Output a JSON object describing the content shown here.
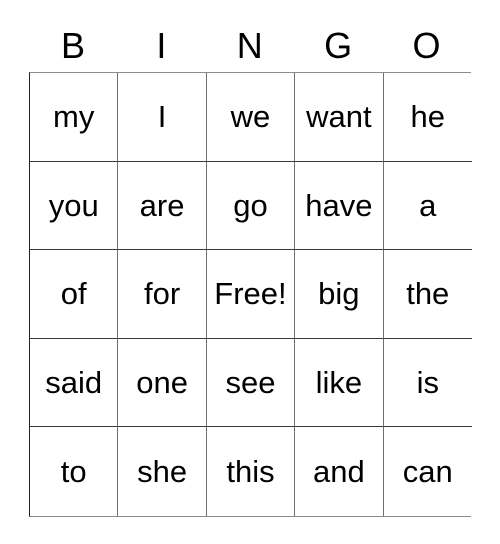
{
  "card": {
    "title": "BINGO",
    "free_space_label": "Free!",
    "free_space_position": {
      "row": 2,
      "column": 2
    },
    "grid_size": "5x5",
    "text_color": "#000000",
    "background_color": "#ffffff",
    "border_color": "#6f6f6f"
  },
  "header": {
    "letters": [
      "B",
      "I",
      "N",
      "G",
      "O"
    ]
  },
  "grid": {
    "columns": 5,
    "rows": [
      {
        "cells": [
          "my",
          "I",
          "we",
          "want",
          "he"
        ]
      },
      {
        "cells": [
          "you",
          "are",
          "go",
          "have",
          "a"
        ]
      },
      {
        "cells": [
          "of",
          "for",
          "Free!",
          "big",
          "the"
        ]
      },
      {
        "cells": [
          "said",
          "one",
          "see",
          "like",
          "is"
        ]
      },
      {
        "cells": [
          "to",
          "she",
          "this",
          "and",
          "can"
        ]
      }
    ]
  }
}
